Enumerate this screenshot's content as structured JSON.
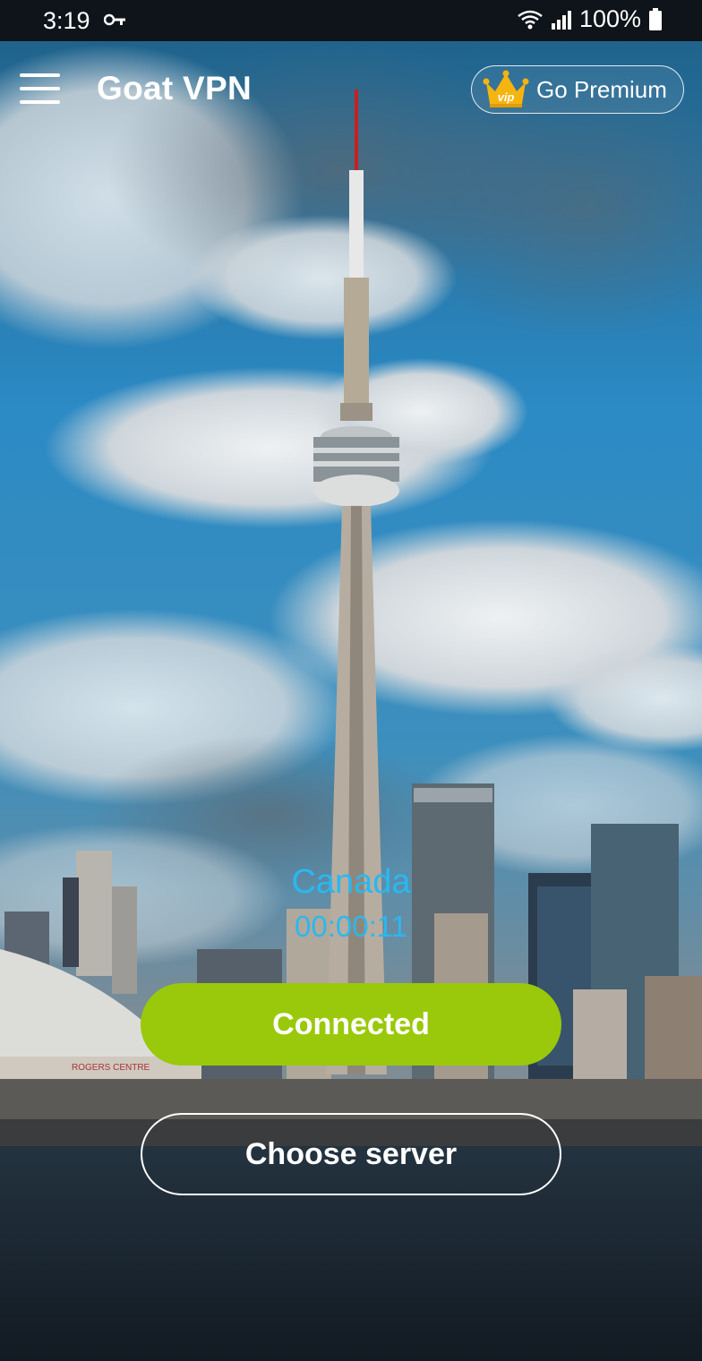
{
  "status_bar": {
    "time": "3:19",
    "battery_percent": "100%",
    "icons": [
      "vpn-key-icon",
      "wifi-icon",
      "signal-icon",
      "battery-icon"
    ]
  },
  "header": {
    "menu_icon": "hamburger-menu-icon",
    "title": "Goat VPN",
    "premium_badge_text": "vip",
    "premium_label": "Go Premium"
  },
  "connection": {
    "country": "Canada",
    "duration": "00:00:11",
    "status_label": "Connected",
    "choose_server_label": "Choose server"
  },
  "background": {
    "signage_text": "ROGERS CENTRE"
  },
  "colors": {
    "accent_blue": "#2ab8f0",
    "connected_green": "#99c90a",
    "crown_gold": "#f6b40f"
  }
}
